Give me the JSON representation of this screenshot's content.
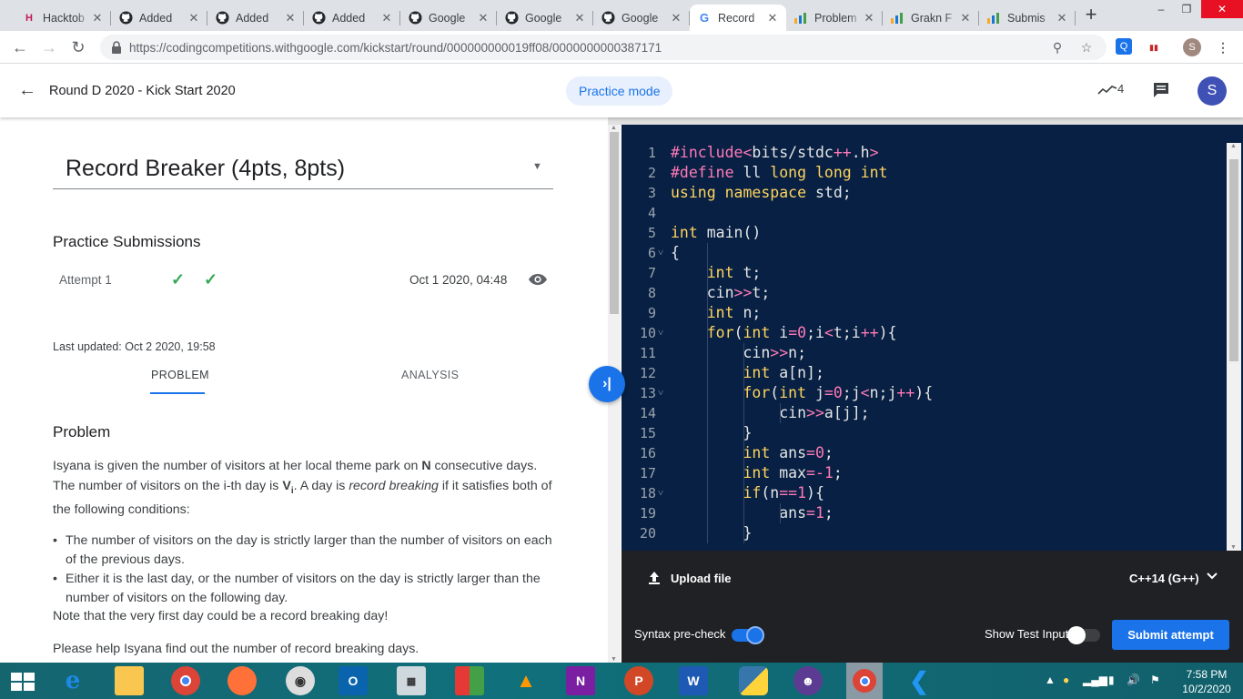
{
  "browser": {
    "tabs": [
      {
        "title": "Hacktob",
        "favicon": "hacktoberfest-icon",
        "active": false
      },
      {
        "title": "Added",
        "favicon": "github-icon",
        "active": false
      },
      {
        "title": "Added",
        "favicon": "github-icon",
        "active": false
      },
      {
        "title": "Added",
        "favicon": "github-icon",
        "active": false
      },
      {
        "title": "Google",
        "favicon": "github-icon",
        "active": false
      },
      {
        "title": "Google",
        "favicon": "github-icon",
        "active": false
      },
      {
        "title": "Google",
        "favicon": "github-icon",
        "active": false
      },
      {
        "title": "Record",
        "favicon": "google-icon",
        "active": true
      },
      {
        "title": "Problem",
        "favicon": "bar-chart-icon",
        "active": false
      },
      {
        "title": "Grakn F",
        "favicon": "bar-chart-icon",
        "active": false
      },
      {
        "title": "Submis",
        "favicon": "bar-chart-icon",
        "active": false
      }
    ],
    "url": "https://codingcompetitions.withgoogle.com/kickstart/round/000000000019ff08/0000000000387171",
    "profile_initial": "S"
  },
  "appbar": {
    "title": "Round D 2020 - Kick Start 2020",
    "mode": "Practice mode",
    "trend_count": "4",
    "avatar": "S"
  },
  "problem": {
    "title": "Record Breaker (4pts, 8pts)",
    "submissions_heading": "Practice Submissions",
    "attempt": {
      "label": "Attempt 1",
      "date": "Oct 1 2020, 04:48"
    },
    "last_updated": "Last updated: Oct 2 2020, 19:58",
    "tabs": [
      "PROBLEM",
      "ANALYSIS"
    ],
    "active_tab": "PROBLEM",
    "section_heading": "Problem",
    "para1_a": "Isyana is given the number of visitors at her local theme park on ",
    "para1_b": "N",
    "para1_c": " consecutive days. The number of visitors on the i-th day is ",
    "para1_d": "V",
    "para1_e": "i",
    "para1_f": ". A day is ",
    "para1_g": "record breaking",
    "para1_h": " if it satisfies both of the following conditions:",
    "bullets": [
      "The number of visitors on the day is strictly larger than the number of visitors on each of the previous days.",
      "Either it is the last day, or the number of visitors on the day is strictly larger than the number of visitors on the following day."
    ],
    "note": "Note that the very first day could be a record breaking day!",
    "help": "Please help Isyana find out the number of record breaking days."
  },
  "editor": {
    "lines": [
      "#include<bits/stdc++.h>",
      "#define ll long long int",
      "using namespace std;",
      "",
      "int main()",
      "{",
      "    int t;",
      "    cin>>t;",
      "    int n;",
      "    for(int i=0;i<t;i++){",
      "        cin>>n;",
      "        int a[n];",
      "        for(int j=0;j<n;j++){",
      "            cin>>a[j];",
      "        }",
      "        int ans=0;",
      "        int max=-1;",
      "        if(n==1){",
      "            ans=1;",
      "        }"
    ],
    "upload_label": "Upload file",
    "language": "C++14 (G++)",
    "syntax_label": "Syntax pre-check",
    "syntax_on": true,
    "show_test_label": "Show Test Input",
    "show_test_on": false,
    "submit_label": "Submit attempt"
  },
  "taskbar": {
    "time": "7:58 PM",
    "date": "10/2/2020"
  },
  "colors": {
    "accent": "#1a73e8",
    "editor_bg": "#072043",
    "keyword": "#ffd45e",
    "preprocessor": "#ff7ab6"
  }
}
